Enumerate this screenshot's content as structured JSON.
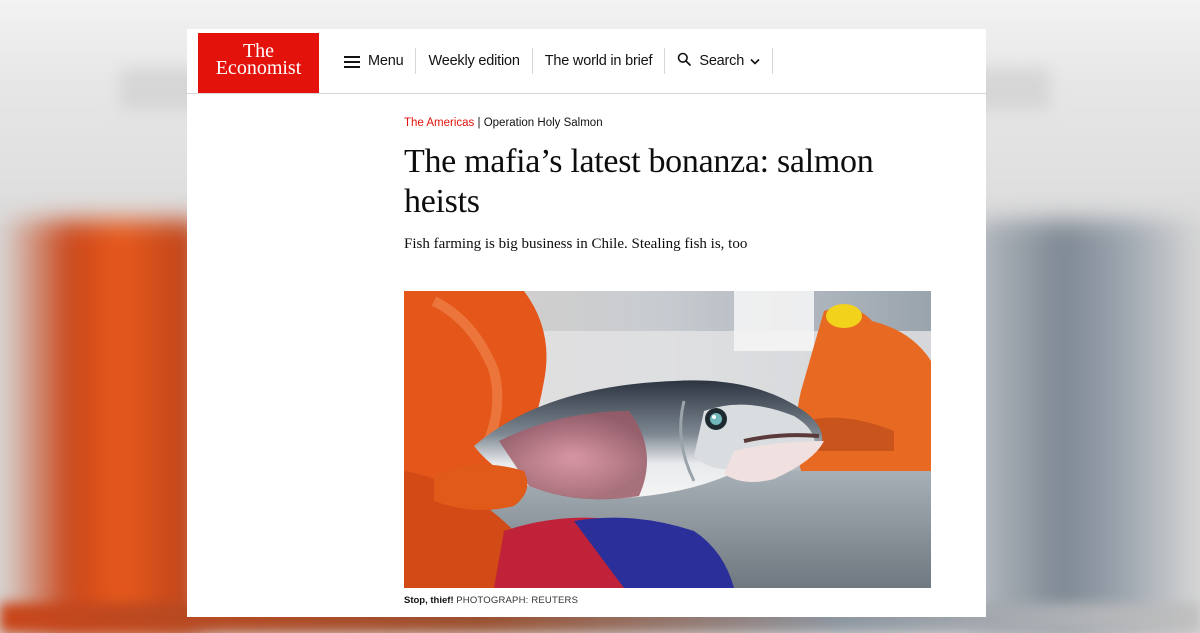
{
  "logo": {
    "line1": "The",
    "line2": "Economist",
    "brand_color": "#e3120b"
  },
  "nav": {
    "menu_label": "Menu",
    "menu_icon": "hamburger-icon",
    "weekly_edition": "Weekly edition",
    "world_in_brief": "The world in brief",
    "search_label": "Search",
    "search_icon": "search-icon",
    "dropdown_icon": "chevron-down-icon"
  },
  "article": {
    "section": "The Americas",
    "separator": " | ",
    "topic": "Operation Holy Salmon",
    "headline": "The mafia’s latest bonanza: salmon heists",
    "rubric": "Fish farming is big business in Chile. Stealing fish is, too",
    "caption": "Stop, thief!",
    "credit": "Photograph: Reuters"
  }
}
